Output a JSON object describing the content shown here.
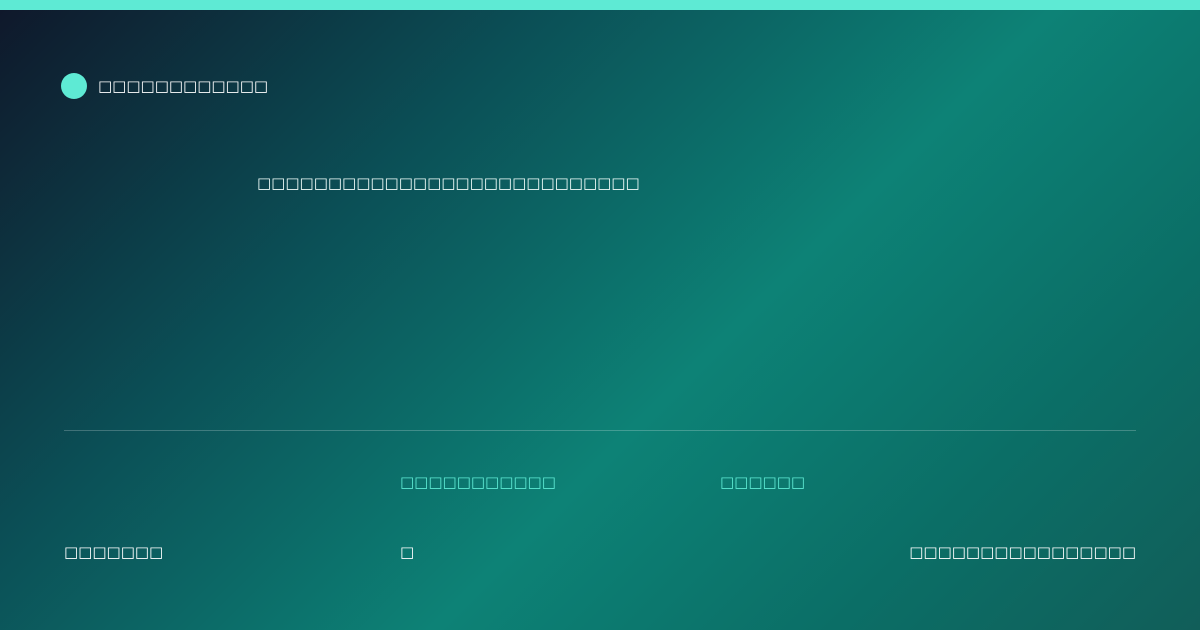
{
  "colors": {
    "accent": "#5eead4",
    "background_start": "#0f172a",
    "background_mid": "#0d8276",
    "background_end": "#115e59"
  },
  "brand": {
    "icon": "brand-dot-icon",
    "name": "□□□□□□□□□□□□"
  },
  "headline": {
    "text": "□□□□□□□□□□□□□□□□□□□□□□□□□□□"
  },
  "meta": {
    "col1_label": "□□□□□□□□□□□",
    "col2_label": "□□□□□□"
  },
  "footer": {
    "left_text": "□□□□□□□",
    "mid_text": "□",
    "right_text": "□□□□□□□□□□□□□□□□"
  }
}
